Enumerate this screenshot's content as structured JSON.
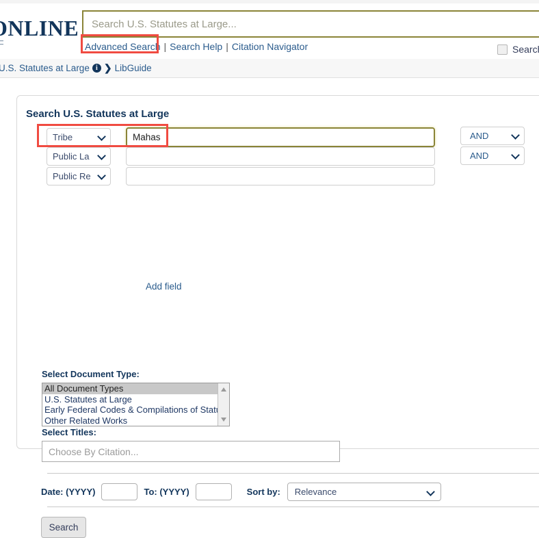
{
  "header": {
    "logo_text": "ONLINE",
    "search_placeholder": "Search U.S. Statutes at Large...",
    "search_value": "",
    "links": {
      "advanced_search": "Advanced Search",
      "separator_1": "|",
      "search_help": "Search Help",
      "separator_2": "|",
      "citation_navigator": "Citation Navigator"
    },
    "checkbox_label": "Search"
  },
  "breadcrumb": {
    "item_1": "U.S. Statutes at Large",
    "info_icon_glyph": "i",
    "chevron_glyph": "❯",
    "item_2": "LibGuide"
  },
  "main": {
    "card_title": "Search U.S. Statutes at Large",
    "query_rows": [
      {
        "field": "Tribe",
        "term": "Mahas",
        "operator": "AND"
      },
      {
        "field": "Public La",
        "term": "",
        "operator": "AND"
      },
      {
        "field": "Public Re",
        "term": "",
        "operator": ""
      }
    ],
    "add_field_label": "Add field",
    "doc_type_label": "Select Document Type:",
    "doc_types": [
      "All Document Types",
      "U.S. Statutes at Large",
      "Early Federal Codes & Compilations of Statutes",
      "Other Related Works"
    ],
    "doc_type_selected": "All Document Types",
    "titles_label": "Select Titles:",
    "citation_placeholder": "Choose By Citation...",
    "citation_value": "",
    "date_label": "Date: (YYYY)",
    "date_from": "",
    "date_to_label": "To: (YYYY)",
    "date_to": "",
    "sort_label": "Sort by:",
    "sort_value": "Relevance",
    "search_button": "Search"
  },
  "colors": {
    "brand_navy": "#12355b",
    "accent_olive": "#8a8437",
    "link_blue": "#2a5b8c",
    "highlight_red": "#f04b41"
  }
}
